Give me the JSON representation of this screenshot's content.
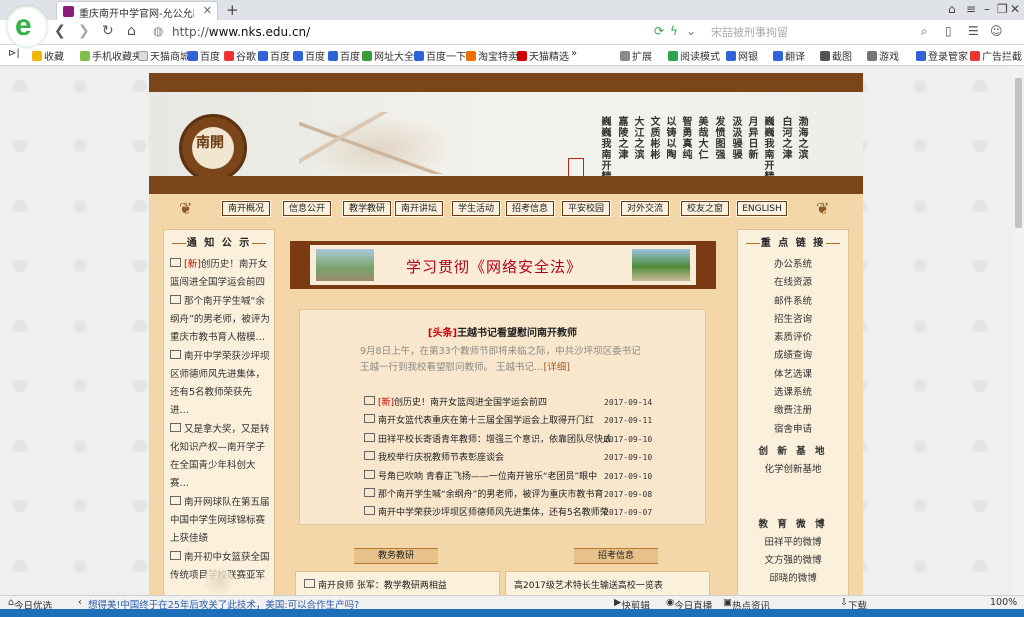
{
  "browser": {
    "tab_title": "重庆南开中学官网-允公允能 日新月异",
    "url_prefix": "http://",
    "url_domain": "www.nks.edu.cn/",
    "search_placeholder": "宋喆被刑事拘留",
    "icons": [
      "back-icon",
      "forward-icon",
      "home-icon",
      "refresh-icon",
      "search-icon"
    ]
  },
  "bookmarks": [
    {
      "label": "收藏",
      "icon": "star-icon"
    },
    {
      "label": "手机收藏夹",
      "icon": "folder-icon"
    },
    {
      "label": "天猫商城",
      "icon": "page-icon"
    },
    {
      "label": "百度",
      "icon": "baidu-icon"
    },
    {
      "label": "谷歌",
      "icon": "google-icon"
    },
    {
      "label": "百度",
      "icon": "baidu-icon"
    },
    {
      "label": "百度",
      "icon": "baidu-icon"
    },
    {
      "label": "百度",
      "icon": "baidu-icon"
    },
    {
      "label": "网址大全",
      "icon": "globe-icon"
    },
    {
      "label": "百度一下",
      "icon": "baidu-icon"
    },
    {
      "label": "淘宝特卖",
      "icon": "taobao-icon"
    },
    {
      "label": "天猫精选",
      "icon": "tmall-icon"
    },
    {
      "label": "»",
      "icon": "more-icon"
    }
  ],
  "toolbar_right": [
    {
      "label": "扩展"
    },
    {
      "label": "阅读模式"
    },
    {
      "label": "网银"
    },
    {
      "label": "翻译"
    },
    {
      "label": "截图"
    },
    {
      "label": "游戏"
    },
    {
      "label": "登录管家"
    },
    {
      "label": "广告拦截"
    }
  ],
  "site": {
    "emblem_text": "南開",
    "poem_columns": [
      "渤海之滨",
      "白河之津",
      "巍巍我南开精神",
      "月异日新",
      "汲汲骎骎",
      "发愤图强",
      "美哉大仁",
      "智勇真纯",
      "以铸以陶",
      "文质彬彬",
      "大江之滨",
      "嘉陵之津",
      "巍巍我南开精神"
    ],
    "menu": [
      "南开概况",
      "信息公开",
      "教学教研",
      "南开讲坛",
      "学生活动",
      "招考信息",
      "平安校园",
      "对外交流",
      "校友之窗",
      "ENGLISH"
    ],
    "notice_title": "通 知 公 示",
    "notices": [
      {
        "new": "[新]",
        "text": "创历史！南开女篮闯进全国学运会前四"
      },
      {
        "new": "",
        "text": "那个南开学生喊“余纲舟”的男老师，被评为重庆市教书育人楷模…"
      },
      {
        "new": "",
        "text": "南开中学荣获沙坪坝区师德师风先进集体，还有5名教师荣获先进…"
      },
      {
        "new": "",
        "text": "又是拿大奖，又是转化知识产权—南开学子在全国青少年科创大赛…"
      },
      {
        "new": "",
        "text": "南开网球队在第五届中国中学生网球锦标赛上获佳绩"
      },
      {
        "new": "",
        "text": "南开初中女篮获全国传统项目学校联赛亚军"
      }
    ],
    "hero_title": "学习贯彻《网络安全法》",
    "headline_tag": "[头条]",
    "headline": "王越书记看望慰问南开教师",
    "summary": "9月8日上午，在第33个教师节即将来临之际，中共沙坪坝区委书记王越一行到我校看望慰问教师。 王越书记…",
    "summary_more": "[详细]",
    "news": [
      {
        "new": "[新]",
        "text": "创历史！南开女篮闯进全国学运会前四",
        "date": "2017-09-14"
      },
      {
        "new": "",
        "text": "南开女篮代表重庆在第十三届全国学运会上取得开门红",
        "date": "2017-09-11"
      },
      {
        "new": "",
        "text": "田祥平校长寄语青年教师：增强三个意识，依靠团队尽快成",
        "date": "2017-09-10"
      },
      {
        "new": "",
        "text": "我校举行庆祝教师节表彰座谈会",
        "date": "2017-09-10"
      },
      {
        "new": "",
        "text": "号角已吹响 青春正飞扬——一位南开管乐“老团员”眼中",
        "date": "2017-09-10"
      },
      {
        "new": "",
        "text": "那个南开学生喊“余纲舟”的男老师，被评为重庆市教书育",
        "date": "2017-09-08"
      },
      {
        "new": "",
        "text": "南开中学荣获沙坪坝区师德师风先进集体，还有5名教师荣",
        "date": "2017-09-07"
      }
    ],
    "links_title": "重 点 链 接",
    "links": [
      "办公系统",
      "在线资源",
      "邮件系统",
      "招生咨询",
      "素质评价",
      "成绩查询",
      "体艺选课",
      "选课系统",
      "缴费注册",
      "宿舍申请"
    ],
    "innovation_title": "创 新 基 地",
    "innovation": [
      "化学创新基地"
    ],
    "weibo_title": "教 育 微 博",
    "weibo": [
      "田祥平的微博",
      "文方强的微博",
      "邱晓的微博"
    ],
    "section_left": "教务教研",
    "section_right": "招考信息",
    "lower_left": "南开良师 张军：教学教研两相益",
    "lower_right": "高2017级艺术特长生输送高校一览表"
  },
  "statusbar": {
    "left": "今日优选",
    "headline": "想得美!中国终于在25年后攻关了此技术，美国:可以合作生产吗?",
    "items": [
      "快剪辑",
      "今日直播",
      "热点资讯",
      "下载",
      "100%"
    ]
  }
}
